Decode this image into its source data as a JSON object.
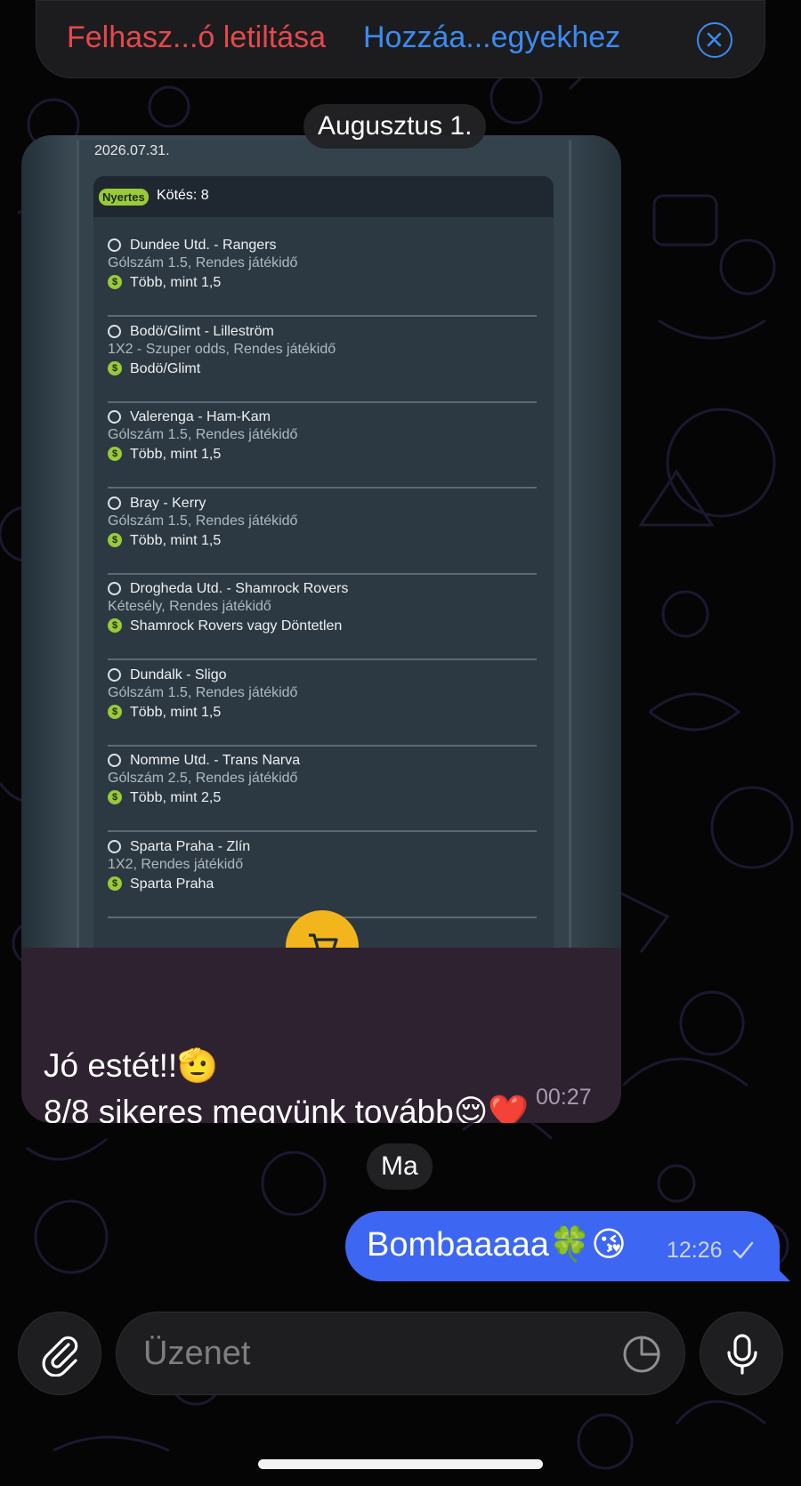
{
  "top_bar": {
    "block_user_label": "Felhasz...ó letiltása",
    "add_contact_label": "Hozzáa...egyekhez"
  },
  "chat": {
    "date_divider_1": "Augusztus 1.",
    "date_divider_2": "Ma",
    "incoming": {
      "screenshot": {
        "date": "2026.07.31.",
        "badge": "Nyertes",
        "stakes": "Kötés: 8",
        "bets": [
          {
            "match": "Dundee Utd. - Rangers",
            "market": "Gólszám 1.5, Rendes játékidő",
            "pick": "Több, mint 1,5"
          },
          {
            "match": "Bodö/Glimt - Lilleström",
            "market": "1X2 - Szuper odds, Rendes játékidő",
            "pick": "Bodö/Glimt"
          },
          {
            "match": "Valerenga - Ham-Kam",
            "market": "Gólszám 1.5, Rendes játékidő",
            "pick": "Több, mint 1,5"
          },
          {
            "match": "Bray - Kerry",
            "market": "Gólszám 1.5, Rendes játékidő",
            "pick": "Több, mint 1,5"
          },
          {
            "match": "Drogheda Utd. - Shamrock Rovers",
            "market": "Kétesély, Rendes játékidő",
            "pick": "Shamrock Rovers vagy Döntetlen"
          },
          {
            "match": "Dundalk - Sligo",
            "market": "Gólszám 1.5, Rendes játékidő",
            "pick": "Több, mint 1,5"
          },
          {
            "match": "Nomme Utd. - Trans Narva",
            "market": "Gólszám 2.5, Rendes játékidő",
            "pick": "Több, mint 2,5"
          },
          {
            "match": "Sparta Praha - Zlín",
            "market": "1X2, Rendes játékidő",
            "pick": "Sparta Praha"
          }
        ]
      },
      "text_line_1": "Jó estét!!🫡",
      "text_line_2": "8/8 sikeres megyünk tovább😌❤️",
      "text_line_3": "❤️✅",
      "time": "00:27"
    },
    "outgoing": {
      "text": "Bombaaaaa🍀😘",
      "time": "12:26"
    }
  },
  "composer": {
    "placeholder": "Üzenet"
  },
  "colors": {
    "danger": "#e5484d",
    "link": "#3c8bf2",
    "outgoing_bubble": "#3d67f2",
    "incoming_bubble": "#2e2230",
    "win_badge": "#9ac93a",
    "cart_button": "#f2b51c"
  },
  "icons": [
    "close-icon",
    "soccer-ball-icon",
    "dollar-icon",
    "cart-icon",
    "check-icon",
    "paperclip-icon",
    "sticker-icon",
    "microphone-icon"
  ]
}
